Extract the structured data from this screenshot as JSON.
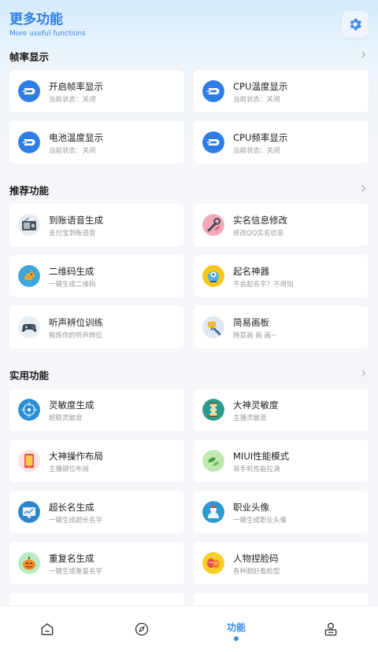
{
  "header": {
    "title": "更多功能",
    "subtitle": "More useful functions"
  },
  "sections": {
    "fps": {
      "title": "帧率显示"
    },
    "recommend": {
      "title": "推荐功能"
    },
    "practical": {
      "title": "实用功能"
    }
  },
  "fps_items": [
    {
      "name": "开启帧率显示",
      "desc": "当前状态：关闭"
    },
    {
      "name": "CPU温度显示",
      "desc": "当前状态：关闭"
    },
    {
      "name": "电池温度显示",
      "desc": "当前状态：关闭"
    },
    {
      "name": "CPU频率显示",
      "desc": "当前状态：关闭"
    }
  ],
  "recommend_items": [
    {
      "name": "到账语音生成",
      "desc": "支付宝到账语音",
      "icon": "radio-icon"
    },
    {
      "name": "实名信息修改",
      "desc": "修改QQ实名信息",
      "icon": "wrench-icon"
    },
    {
      "name": "二维码生成",
      "desc": "一键生成二维码",
      "icon": "dog-icon"
    },
    {
      "name": "起名神器",
      "desc": "不会起名字？不用怕",
      "icon": "brain-icon"
    },
    {
      "name": "听声辨位训练",
      "desc": "锻炼你的听声辨位",
      "icon": "gamepad-icon"
    },
    {
      "name": "简易画板",
      "desc": "随意画 画 画~",
      "icon": "paint-icon"
    }
  ],
  "practical_items": [
    {
      "name": "灵敏度生成",
      "desc": "超稳灵敏度",
      "icon": "target-icon"
    },
    {
      "name": "大神灵敏度",
      "desc": "主播灵敏度",
      "icon": "hourglass-icon"
    },
    {
      "name": "大神操作布局",
      "desc": "主播键位布局",
      "icon": "tablet-icon"
    },
    {
      "name": "MIUI性能模式",
      "desc": "将手机性能拉满",
      "icon": "leaf-icon"
    },
    {
      "name": "超长名生成",
      "desc": "一键生成超长名字",
      "icon": "monitor-icon"
    },
    {
      "name": "职业头像",
      "desc": "一键生成职业头像",
      "icon": "avatar-icon"
    },
    {
      "name": "重复名生成",
      "desc": "一键生成重复名字",
      "icon": "pumpkin-icon"
    },
    {
      "name": "人物捏脸码",
      "desc": "各种超好看脸型",
      "icon": "masks-icon"
    }
  ],
  "tabbar": {
    "active_label": "功能"
  },
  "colors": {
    "accent": "#3a8cf0",
    "dash_icon": "#2d7de8"
  }
}
